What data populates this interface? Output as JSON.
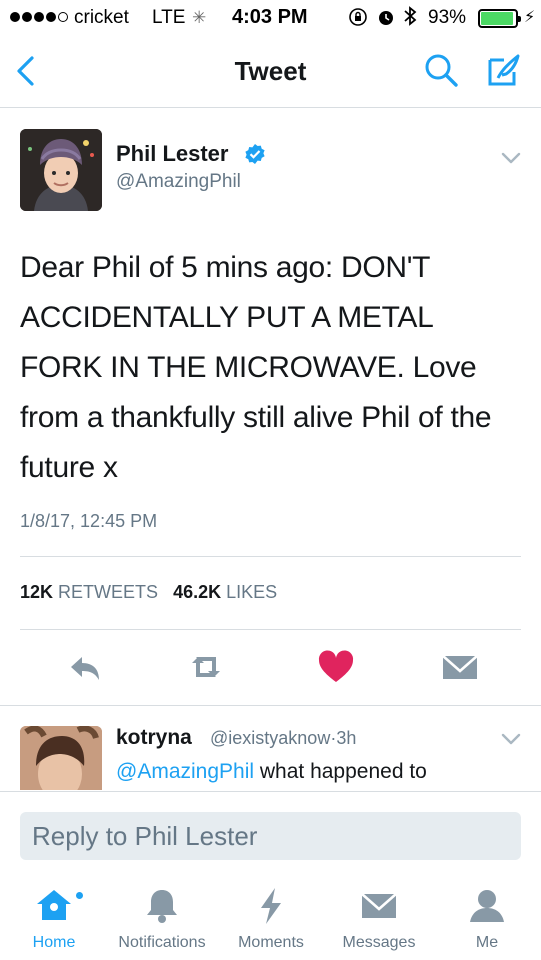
{
  "status_bar": {
    "carrier": "cricket",
    "network": "LTE",
    "time": "4:03 PM",
    "battery_percent": "93%",
    "battery_level": 0.93,
    "signal_bars": 4,
    "signal_total": 5
  },
  "nav": {
    "title": "Tweet"
  },
  "tweet": {
    "author_name": "Phil Lester",
    "author_handle": "@AmazingPhil",
    "verified": true,
    "text": "Dear Phil of 5 mins ago: DON'T ACCIDENTALLY PUT A METAL FORK IN THE MICROWAVE. Love from a thankfully still alive Phil of the future x",
    "timestamp": "1/8/17, 12:45 PM",
    "retweets_count": "12K",
    "retweets_label": "RETWEETS",
    "likes_count": "46.2K",
    "likes_label": "LIKES",
    "liked": true
  },
  "reply": {
    "author_name": "kotryna",
    "author_handle": "@iexistyaknow",
    "separator": "·",
    "age": "3h",
    "mention": "@AmazingPhil",
    "text": " what happened to"
  },
  "composer": {
    "placeholder": "Reply to Phil Lester"
  },
  "tabs": [
    {
      "label": "Home",
      "icon": "home-icon",
      "active": true
    },
    {
      "label": "Notifications",
      "icon": "bell-icon",
      "active": false
    },
    {
      "label": "Moments",
      "icon": "lightning-icon",
      "active": false
    },
    {
      "label": "Messages",
      "icon": "envelope-icon",
      "active": false
    },
    {
      "label": "Me",
      "icon": "person-icon",
      "active": false
    }
  ],
  "colors": {
    "accent": "#1da1f2",
    "like": "#e0245e",
    "muted": "#657786",
    "action_gray": "#aab8c2"
  }
}
